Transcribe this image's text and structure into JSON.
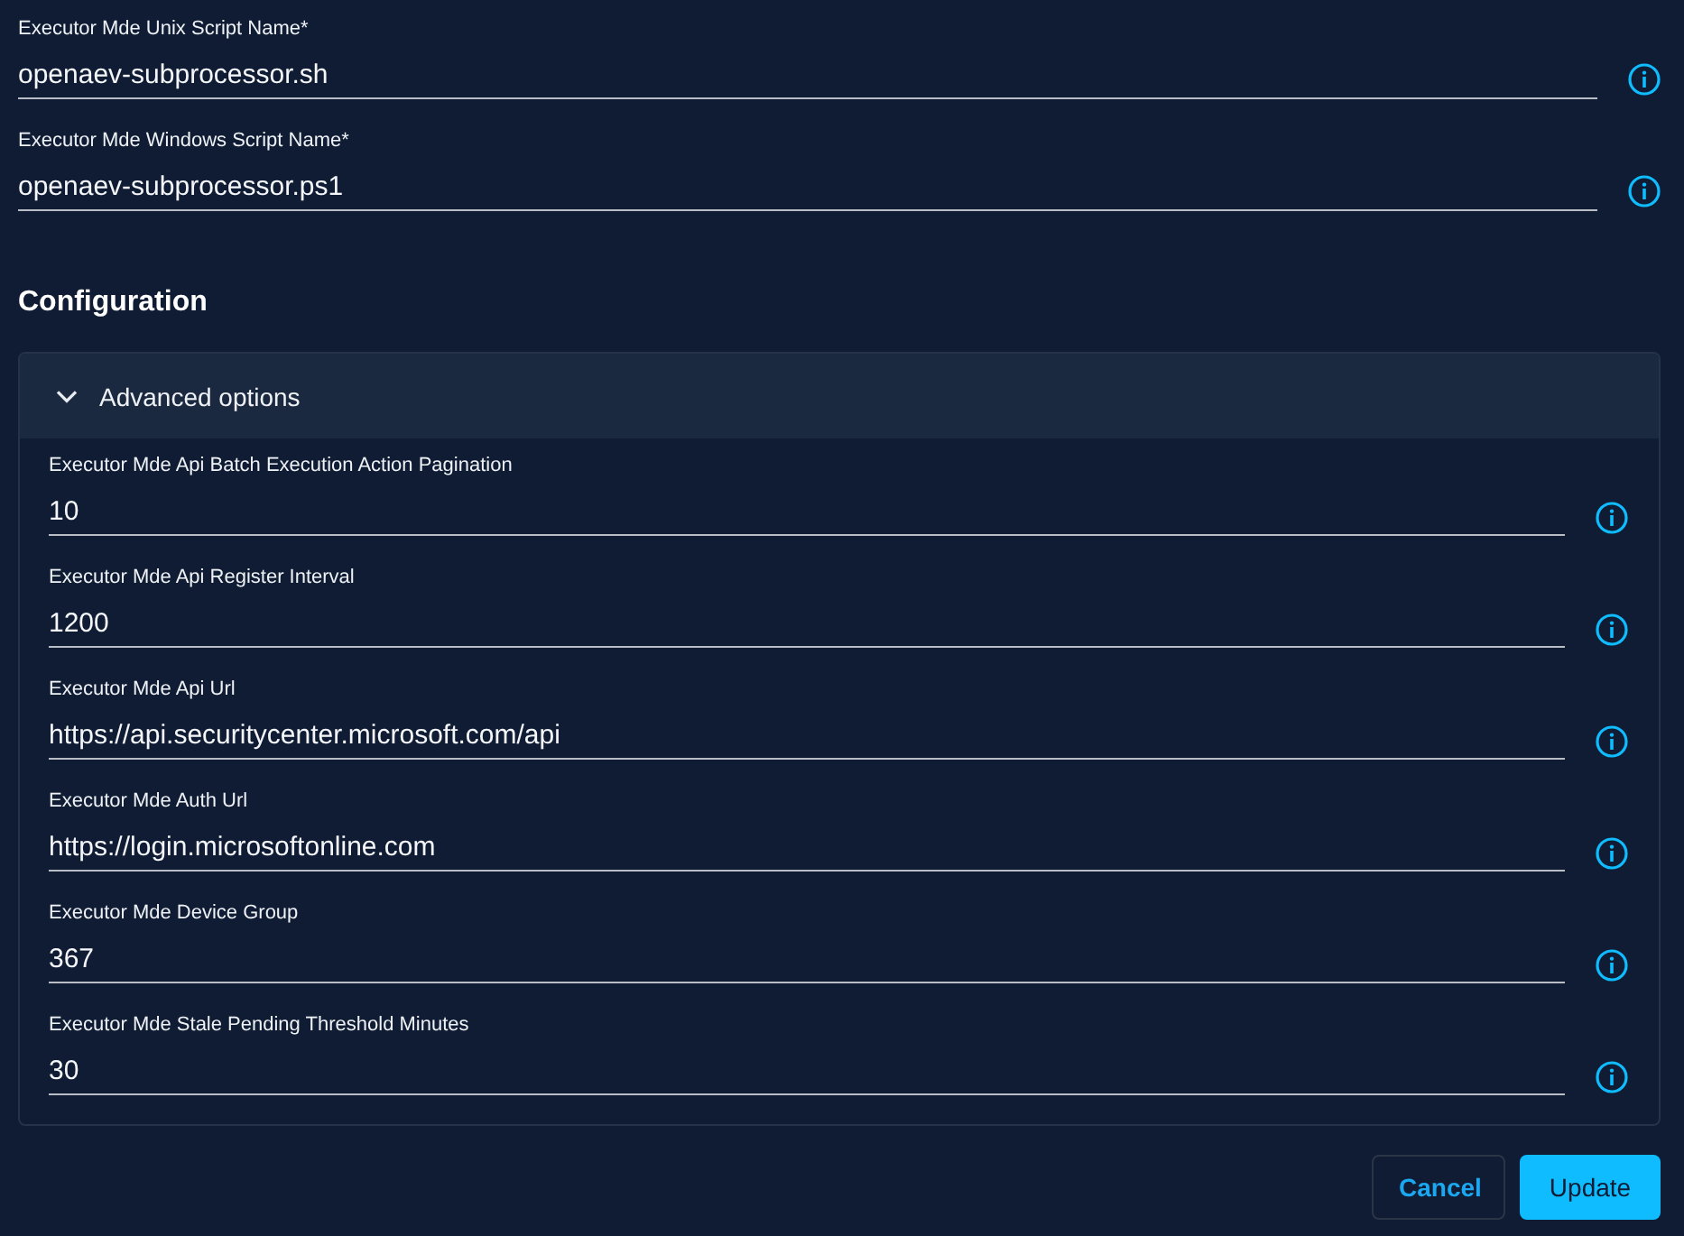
{
  "fields": [
    {
      "label": "Executor Mde Unix Script Name*",
      "value": "openaev-subprocessor.sh"
    },
    {
      "label": "Executor Mde Windows Script Name*",
      "value": "openaev-subprocessor.ps1"
    }
  ],
  "configuration": {
    "title": "Configuration",
    "accordion": {
      "title": "Advanced options",
      "expanded": true,
      "fields": [
        {
          "label": "Executor Mde Api Batch Execution Action Pagination",
          "value": "10"
        },
        {
          "label": "Executor Mde Api Register Interval",
          "value": "1200"
        },
        {
          "label": "Executor Mde Api Url",
          "value": "https://api.securitycenter.microsoft.com/api"
        },
        {
          "label": "Executor Mde Auth Url",
          "value": "https://login.microsoftonline.com"
        },
        {
          "label": "Executor Mde Device Group",
          "value": "367"
        },
        {
          "label": "Executor Mde Stale Pending Threshold Minutes",
          "value": "30"
        }
      ]
    }
  },
  "buttons": [
    {
      "label": "Cancel",
      "kind": "secondary"
    },
    {
      "label": "Update",
      "kind": "primary"
    }
  ]
}
